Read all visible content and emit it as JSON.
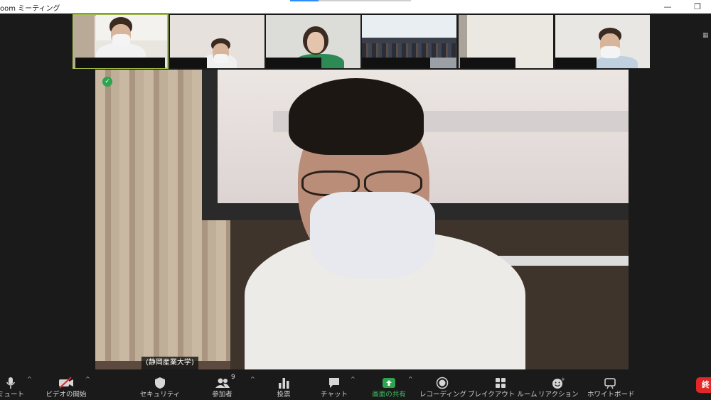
{
  "window": {
    "title": "oom ミーティング",
    "minimize": "—",
    "restore": "❐"
  },
  "main_video": {
    "name_label": "(静岡産業大学)"
  },
  "toolbar": {
    "mute": "ミュート",
    "start_video": "ビデオの開始",
    "security": "セキュリティ",
    "participants": "参加者",
    "participant_count": "9",
    "polls": "投票",
    "chat": "チャット",
    "share_screen": "画面の共有",
    "recording": "レコーディング",
    "breakout": "ブレイクアウト ルーム",
    "reactions": "リアクション",
    "whiteboard": "ホワイトボード",
    "end": "終"
  },
  "colors": {
    "accent_green": "#2ea44f",
    "active_speaker_border": "#a6c64a",
    "end_button": "#e02828",
    "toolbar_bg": "#1a1a1a"
  },
  "icons": {
    "mute": "microphone-icon",
    "video": "video-off-icon",
    "security": "shield-icon",
    "participants": "people-icon",
    "polls": "bar-chart-icon",
    "chat": "chat-bubble-icon",
    "share": "share-screen-icon",
    "record": "record-icon",
    "breakout": "grid-icon",
    "reactions": "emoji-icon",
    "whiteboard": "whiteboard-icon"
  }
}
